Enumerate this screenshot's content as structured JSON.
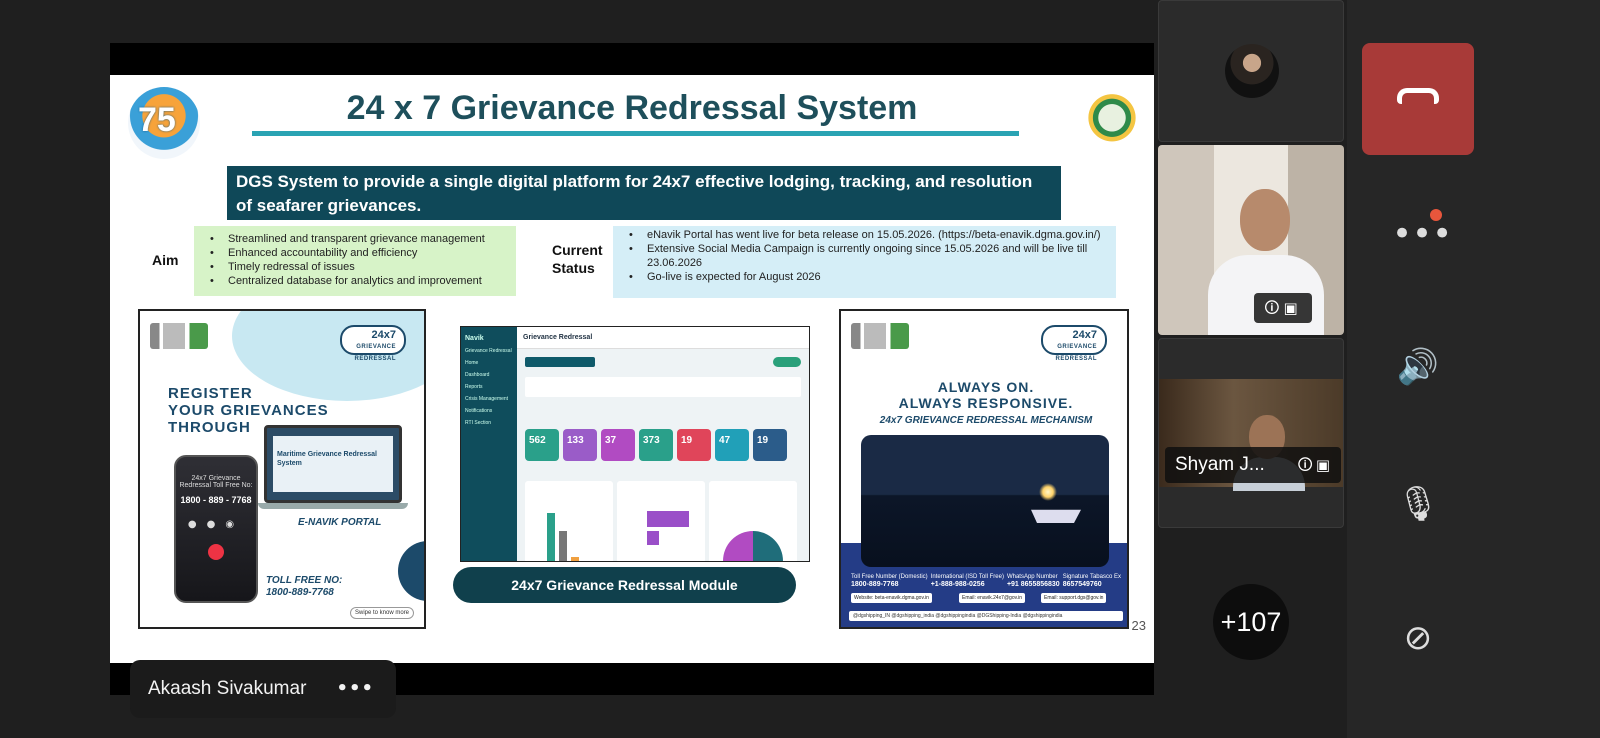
{
  "slide": {
    "logo_left_text": "75",
    "title": "24 x 7 Grievance Redressal System",
    "banner": "DGS System to provide a single digital platform for 24x7 effective lodging, tracking, and resolution of seafarer grievances.",
    "aim_label": "Aim",
    "aim_items": [
      "Streamlined and transparent grievance management",
      "Enhanced accountability and efficiency",
      "Timely redressal of issues",
      "Centralized database for analytics and improvement"
    ],
    "status_label": "Current Status",
    "status_items": [
      "eNavik Portal has went live for beta release on 15.05.2026. (https://beta-enavik.dgma.gov.in/)",
      "Extensive Social Media Campaign is currently ongoing since 15.05.2026 and will be live till 23.06.2026",
      "Go-live is expected for August 2026"
    ],
    "poster_left": {
      "badge_top": "24x7",
      "badge_sub": "GRIEVANCE REDRESSAL",
      "heading_lines": [
        "REGISTER",
        "YOUR GRIEVANCES",
        "THROUGH"
      ],
      "phone_title": "24x7 Grievance Redressal Toll Free No:",
      "phone_number": "1800 - 889 - 7768",
      "laptop_text": "Maritime Grievance Redressal System",
      "portal_label": "E-NAVIK PORTAL",
      "tollfree_label": "TOLL FREE NO:",
      "tollfree_number": "1800-889-7768",
      "swipe": "Swipe to know more"
    },
    "dashboard": {
      "app": "Navik",
      "page": "Grievance Redressal",
      "menu": [
        "Grievance Redressal",
        "Home",
        "Dashboard",
        "Reports",
        "Crisis Management",
        "Notifications",
        "RTI Section"
      ],
      "tiles": [
        {
          "value": "562",
          "color": "#2aa08a"
        },
        {
          "value": "133",
          "color": "#9a5cc8"
        },
        {
          "value": "37",
          "color": "#b14bc2"
        },
        {
          "value": "373",
          "color": "#2aa08a"
        },
        {
          "value": "19",
          "color": "#e0455a"
        },
        {
          "value": "47",
          "color": "#21a0b8"
        },
        {
          "value": "19",
          "color": "#2b5c8a"
        }
      ]
    },
    "module_button": "24x7 Grievance Redressal Module",
    "poster_right": {
      "badge_top": "24x7",
      "badge_sub": "GRIEVANCE REDRESSAL",
      "heading_lines": [
        "ALWAYS ON.",
        "ALWAYS RESPONSIVE."
      ],
      "mechanism": "24x7 GRIEVANCE REDRESSAL MECHANISM",
      "contacts": [
        {
          "label": "Toll Free Number (Domestic)",
          "value": "1800-889-7768"
        },
        {
          "label": "International (ISD Toll Free)",
          "value": "+1-888-988-0256"
        },
        {
          "label": "WhatsApp Number",
          "value": "+91 8655856830"
        },
        {
          "label": "Signature Tabasco Ex",
          "value": "8657549760"
        }
      ],
      "website": "Website: beta-enavik.dgma.gov.in",
      "email1": "Email: enavik.24x7@gov.in",
      "email2": "Email: support.dgs@gov.in",
      "socials": "@dgshipping_IN   @dgshipping_india   @dgshippingindia   @DGShipping-India   @dgshippingindia"
    },
    "slide_number": "23"
  },
  "presenter_name": "Akaash Sivakumar",
  "participants": {
    "tile3_name": "Shyam J...",
    "overflow_count": "+107"
  },
  "controls": {
    "end_call": "end-call",
    "more": "more-options",
    "speaker": "speaker",
    "mic": "mic-off",
    "camera": "camera-off"
  }
}
